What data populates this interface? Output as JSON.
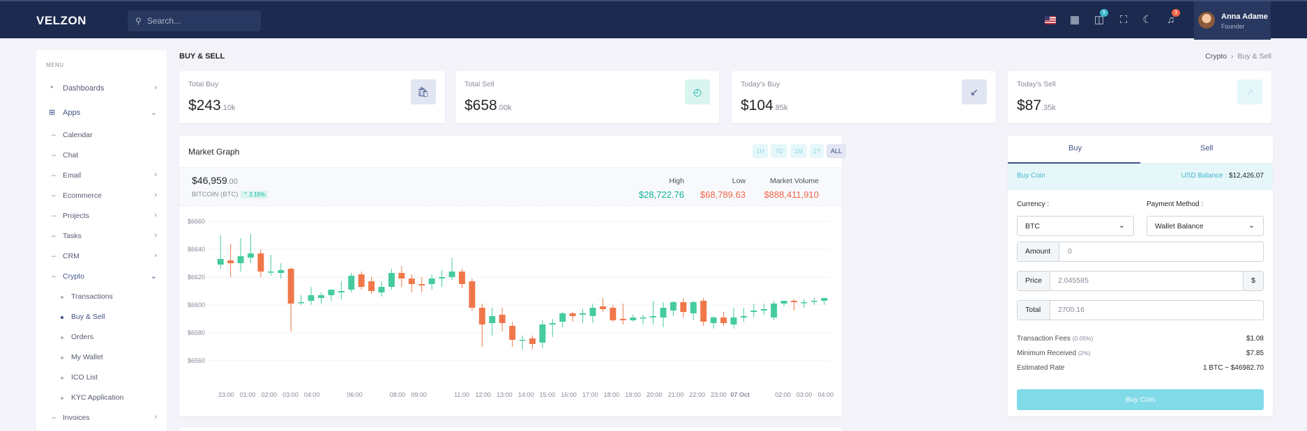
{
  "topbar": {
    "logo": "VELZON",
    "search_placeholder": "Search...",
    "cart_count": "5",
    "notif_count": "3",
    "user": {
      "name": "Anna Adame",
      "role": "Founder"
    }
  },
  "sidebar": {
    "menu_title": "MENU",
    "items": [
      {
        "label": "Dashboards",
        "icon": "dashboard-icon"
      },
      {
        "label": "Apps",
        "icon": "apps-icon"
      },
      {
        "label": "Calendar"
      },
      {
        "label": "Chat"
      },
      {
        "label": "Email"
      },
      {
        "label": "Ecommerce"
      },
      {
        "label": "Projects"
      },
      {
        "label": "Tasks"
      },
      {
        "label": "CRM"
      },
      {
        "label": "Crypto"
      },
      {
        "label": "Transactions"
      },
      {
        "label": "Buy & Sell"
      },
      {
        "label": "Orders"
      },
      {
        "label": "My Wallet"
      },
      {
        "label": "ICO List"
      },
      {
        "label": "KYC Application"
      },
      {
        "label": "Invoices"
      }
    ]
  },
  "page": {
    "title": "BUY & SELL",
    "breadcrumb": [
      "Crypto",
      "Buy & Sell"
    ]
  },
  "stats": [
    {
      "label": "Total Buy",
      "value": "$243",
      "suffix": ".10k",
      "icon": "shopping-bag-icon",
      "color": "#405189",
      "bg": "#e2e5f2"
    },
    {
      "label": "Total Sell",
      "value": "$658",
      "suffix": ".00k",
      "icon": "trending-up-icon",
      "color": "#0ab39c",
      "bg": "#daf4f0"
    },
    {
      "label": "Today's Buy",
      "value": "$104",
      "suffix": ".85k",
      "icon": "arrow-down-left-icon",
      "color": "#405189",
      "bg": "#e2e5f2"
    },
    {
      "label": "Today's Sell",
      "value": "$87",
      "suffix": ".35k",
      "icon": "arrow-up-right-icon",
      "color": "#bde8ef",
      "bg": "#e6f7fa"
    }
  ],
  "market": {
    "title": "Market Graph",
    "ranges": [
      "1H",
      "7D",
      "1M",
      "1Y",
      "ALL"
    ],
    "active_range": "ALL",
    "price": "$46,959",
    "price_decimals": ".00",
    "coin": "BITCOIN (BTC)",
    "change": "2.15%",
    "high_label": "High",
    "high": "$28,722.76",
    "low_label": "Low",
    "low": "$68,789.63",
    "volume_label": "Market Volume",
    "volume": "$888,411,910",
    "colors": {
      "up": "#45cb9f",
      "down": "#f0774a",
      "high": "#0ab39c",
      "low": "#f06548"
    }
  },
  "chart_data": {
    "type": "candlestick",
    "ylim": [
      6550,
      6665
    ],
    "y_ticks": [
      "$6660",
      "$6640",
      "$6620",
      "$6600",
      "$6580",
      "$6560"
    ],
    "x_ticks": [
      "23:00",
      "01:00",
      "02:00",
      "03:00",
      "04:00",
      "06:00",
      "08:00",
      "09:00",
      "11:00",
      "12:00",
      "13:00",
      "14:00",
      "15:00",
      "16:00",
      "17:00",
      "18:00",
      "19:00",
      "20:00",
      "21:00",
      "22:00",
      "23:00",
      "07 Oct",
      "02:00",
      "03:00",
      "04:00"
    ],
    "x_tick_index": [
      1,
      4,
      7,
      10,
      13,
      19,
      25,
      28,
      34,
      37,
      40,
      43,
      46,
      49,
      52,
      55,
      58,
      61,
      64,
      67,
      70,
      73,
      79,
      82,
      85
    ],
    "candles": [
      {
        "o": 6629,
        "h": 6650,
        "l": 6626,
        "c": 6633
      },
      {
        "o": 6632,
        "h": 6644,
        "l": 6620,
        "c": 6630
      },
      {
        "o": 6630,
        "h": 6648,
        "l": 6624,
        "c": 6635
      },
      {
        "o": 6634,
        "h": 6651,
        "l": 6630,
        "c": 6637
      },
      {
        "o": 6637,
        "h": 6640,
        "l": 6620,
        "c": 6624
      },
      {
        "o": 6624,
        "h": 6636,
        "l": 6621,
        "c": 6624
      },
      {
        "o": 6623,
        "h": 6630,
        "l": 6619,
        "c": 6625
      },
      {
        "o": 6626,
        "h": 6627,
        "l": 6581,
        "c": 6601
      },
      {
        "o": 6602,
        "h": 6607,
        "l": 6600,
        "c": 6602
      },
      {
        "o": 6603,
        "h": 6613,
        "l": 6600,
        "c": 6607
      },
      {
        "o": 6605,
        "h": 6609,
        "l": 6601,
        "c": 6607
      },
      {
        "o": 6607,
        "h": 6611,
        "l": 6603,
        "c": 6611
      },
      {
        "o": 6609,
        "h": 6617,
        "l": 6604,
        "c": 6610
      },
      {
        "o": 6611,
        "h": 6623,
        "l": 6609,
        "c": 6621
      },
      {
        "o": 6622,
        "h": 6624,
        "l": 6611,
        "c": 6613
      },
      {
        "o": 6617,
        "h": 6620,
        "l": 6608,
        "c": 6610
      },
      {
        "o": 6609,
        "h": 6617,
        "l": 6606,
        "c": 6613
      },
      {
        "o": 6613,
        "h": 6626,
        "l": 6611,
        "c": 6623
      },
      {
        "o": 6623,
        "h": 6628,
        "l": 6613,
        "c": 6619
      },
      {
        "o": 6619,
        "h": 6622,
        "l": 6609,
        "c": 6615
      },
      {
        "o": 6615,
        "h": 6620,
        "l": 6609,
        "c": 6614
      },
      {
        "o": 6615,
        "h": 6622,
        "l": 6611,
        "c": 6619
      },
      {
        "o": 6619,
        "h": 6625,
        "l": 6613,
        "c": 6620
      },
      {
        "o": 6620,
        "h": 6634,
        "l": 6618,
        "c": 6624
      },
      {
        "o": 6624,
        "h": 6626,
        "l": 6612,
        "c": 6615
      },
      {
        "o": 6617,
        "h": 6619,
        "l": 6596,
        "c": 6598
      },
      {
        "o": 6598,
        "h": 6601,
        "l": 6570,
        "c": 6586
      },
      {
        "o": 6587,
        "h": 6598,
        "l": 6578,
        "c": 6592
      },
      {
        "o": 6593,
        "h": 6598,
        "l": 6581,
        "c": 6587
      },
      {
        "o": 6585,
        "h": 6588,
        "l": 6570,
        "c": 6575
      },
      {
        "o": 6575,
        "h": 6578,
        "l": 6568,
        "c": 6575
      },
      {
        "o": 6576,
        "h": 6578,
        "l": 6568,
        "c": 6572
      },
      {
        "o": 6573,
        "h": 6589,
        "l": 6569,
        "c": 6586
      },
      {
        "o": 6586,
        "h": 6590,
        "l": 6577,
        "c": 6587
      },
      {
        "o": 6588,
        "h": 6595,
        "l": 6584,
        "c": 6594
      },
      {
        "o": 6594,
        "h": 6595,
        "l": 6588,
        "c": 6592
      },
      {
        "o": 6593,
        "h": 6597,
        "l": 6587,
        "c": 6594
      },
      {
        "o": 6592,
        "h": 6601,
        "l": 6587,
        "c": 6598
      },
      {
        "o": 6599,
        "h": 6605,
        "l": 6595,
        "c": 6597
      },
      {
        "o": 6598,
        "h": 6600,
        "l": 6588,
        "c": 6589
      },
      {
        "o": 6590,
        "h": 6601,
        "l": 6586,
        "c": 6589
      },
      {
        "o": 6589,
        "h": 6593,
        "l": 6588,
        "c": 6591
      },
      {
        "o": 6591,
        "h": 6593,
        "l": 6586,
        "c": 6591
      },
      {
        "o": 6591,
        "h": 6603,
        "l": 6586,
        "c": 6592
      },
      {
        "o": 6591,
        "h": 6602,
        "l": 6584,
        "c": 6598
      },
      {
        "o": 6596,
        "h": 6603,
        "l": 6592,
        "c": 6602
      },
      {
        "o": 6602,
        "h": 6605,
        "l": 6591,
        "c": 6595
      },
      {
        "o": 6594,
        "h": 6603,
        "l": 6589,
        "c": 6602
      },
      {
        "o": 6603,
        "h": 6605,
        "l": 6585,
        "c": 6588
      },
      {
        "o": 6587,
        "h": 6592,
        "l": 6583,
        "c": 6591
      },
      {
        "o": 6591,
        "h": 6595,
        "l": 6585,
        "c": 6587
      },
      {
        "o": 6586,
        "h": 6598,
        "l": 6583,
        "c": 6591
      },
      {
        "o": 6591,
        "h": 6598,
        "l": 6588,
        "c": 6592
      },
      {
        "o": 6595,
        "h": 6601,
        "l": 6591,
        "c": 6596
      },
      {
        "o": 6596,
        "h": 6601,
        "l": 6593,
        "c": 6597
      },
      {
        "o": 6591,
        "h": 6603,
        "l": 6589,
        "c": 6601
      },
      {
        "o": 6601,
        "h": 6603,
        "l": 6599,
        "c": 6603
      },
      {
        "o": 6603,
        "h": 6604,
        "l": 6596,
        "c": 6602
      },
      {
        "o": 6602,
        "h": 6604,
        "l": 6598,
        "c": 6602
      },
      {
        "o": 6603,
        "h": 6605,
        "l": 6600,
        "c": 6603
      },
      {
        "o": 6603,
        "h": 6605,
        "l": 6600,
        "c": 6605
      }
    ]
  },
  "trade": {
    "tabs": [
      "Buy",
      "Sell"
    ],
    "active_tab": "Buy",
    "buy_coin_label": "Buy Coin",
    "balance_label": "USD Balance :",
    "balance": "$12,426.07",
    "currency_label": "Currency :",
    "currency": "BTC",
    "payment_label": "Payment Method :",
    "payment": "Wallet Balance",
    "amount_label": "Amount",
    "amount": "0",
    "price_label": "Price",
    "price": "2.045585",
    "price_unit": "$",
    "total_label": "Total",
    "total": "2700.16",
    "fee_label": "Transaction Fees",
    "fee_pct": "(0.05%)",
    "fee": "$1.08",
    "min_label": "Minimum Received",
    "min_pct": "(2%)",
    "min": "$7.85",
    "rate_label": "Estimated Rate",
    "rate": "1 BTC ~ $46982.70",
    "button": "Buy Coin"
  }
}
